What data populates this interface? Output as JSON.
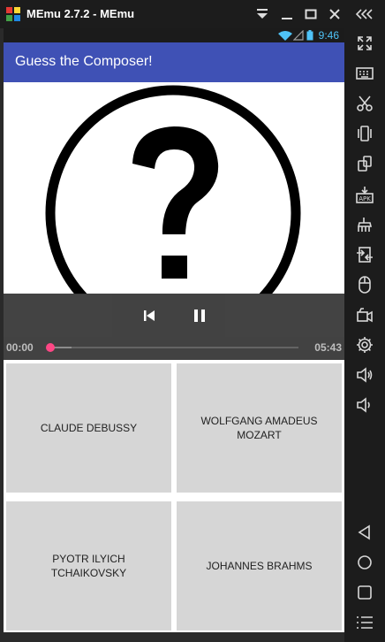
{
  "window": {
    "title": "MEmu 2.7.2 - MEmu",
    "controls": [
      "menu-dropdown-icon",
      "minimize-icon",
      "maximize-icon",
      "close-icon"
    ]
  },
  "status_bar": {
    "time": "9:46"
  },
  "app_bar": {
    "title": "Guess the Composer!"
  },
  "player": {
    "artwork": "question-mark-icon",
    "elapsed": "00:00",
    "duration": "05:43",
    "progress": 0.0,
    "buffered": 0.09
  },
  "answers": [
    {
      "label": "CLAUDE DEBUSSY"
    },
    {
      "label": "WOLFGANG AMADEUS MOZART"
    },
    {
      "label": "PYOTR ILYICH TCHAIKOVSKY"
    },
    {
      "label": "JOHANNES BRAHMS"
    }
  ],
  "side_tools": [
    "collapse-icon",
    "fullscreen-icon",
    "keyboard-icon",
    "scissors-icon",
    "shake-icon",
    "rotate-icon",
    "apk-install-icon",
    "cleanup-icon",
    "file-transfer-icon",
    "mouse-icon",
    "record-video-icon",
    "settings-icon",
    "volume-up-icon",
    "volume-down-icon",
    "back-icon",
    "home-icon",
    "recents-icon",
    "menu-icon"
  ],
  "colors": {
    "app_bar": "#3f51b5",
    "seek_thumb": "#ff4081",
    "status_accent": "#4fc3f7",
    "answer_tile": "#d6d6d6"
  }
}
